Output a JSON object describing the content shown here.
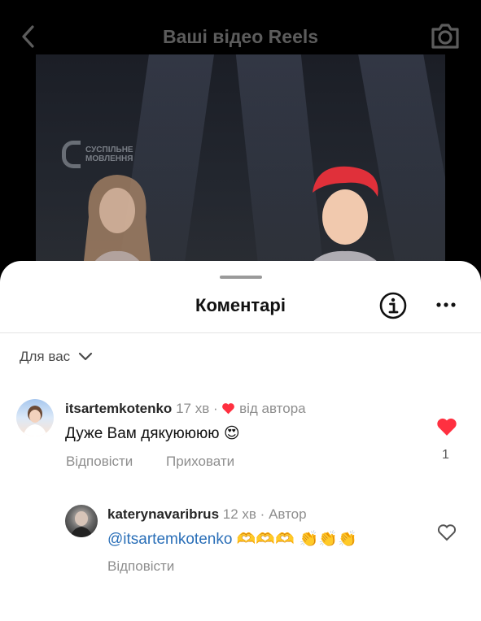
{
  "topbar": {
    "title": "Ваші відео Reels"
  },
  "video": {
    "watermark_line1": "СУСПІЛЬНЕ",
    "watermark_line2": "МОВЛЕННЯ"
  },
  "sheet": {
    "title": "Коментарі",
    "filter_label": "Для вас"
  },
  "comments": [
    {
      "username": "itsartemkotenko",
      "time": "17 хв",
      "separator": "·",
      "liked_by_author": "від автора",
      "text": "Дуже Вам дякуюююю",
      "emoji": "😍",
      "reply_label": "Відповісти",
      "hide_label": "Приховати",
      "like_count": "1",
      "liked": true
    },
    {
      "username": "katerynavaribrus",
      "time": "12 хв",
      "separator": "·",
      "badge": "Автор",
      "mention": "@itsartemkotenko",
      "emoji": "🫶🫶🫶 👏👏👏",
      "reply_label": "Відповісти",
      "liked": false
    }
  ],
  "colors": {
    "heart": "#ff3040",
    "mention": "#2a6fb8",
    "muted": "#8e8e8e"
  }
}
